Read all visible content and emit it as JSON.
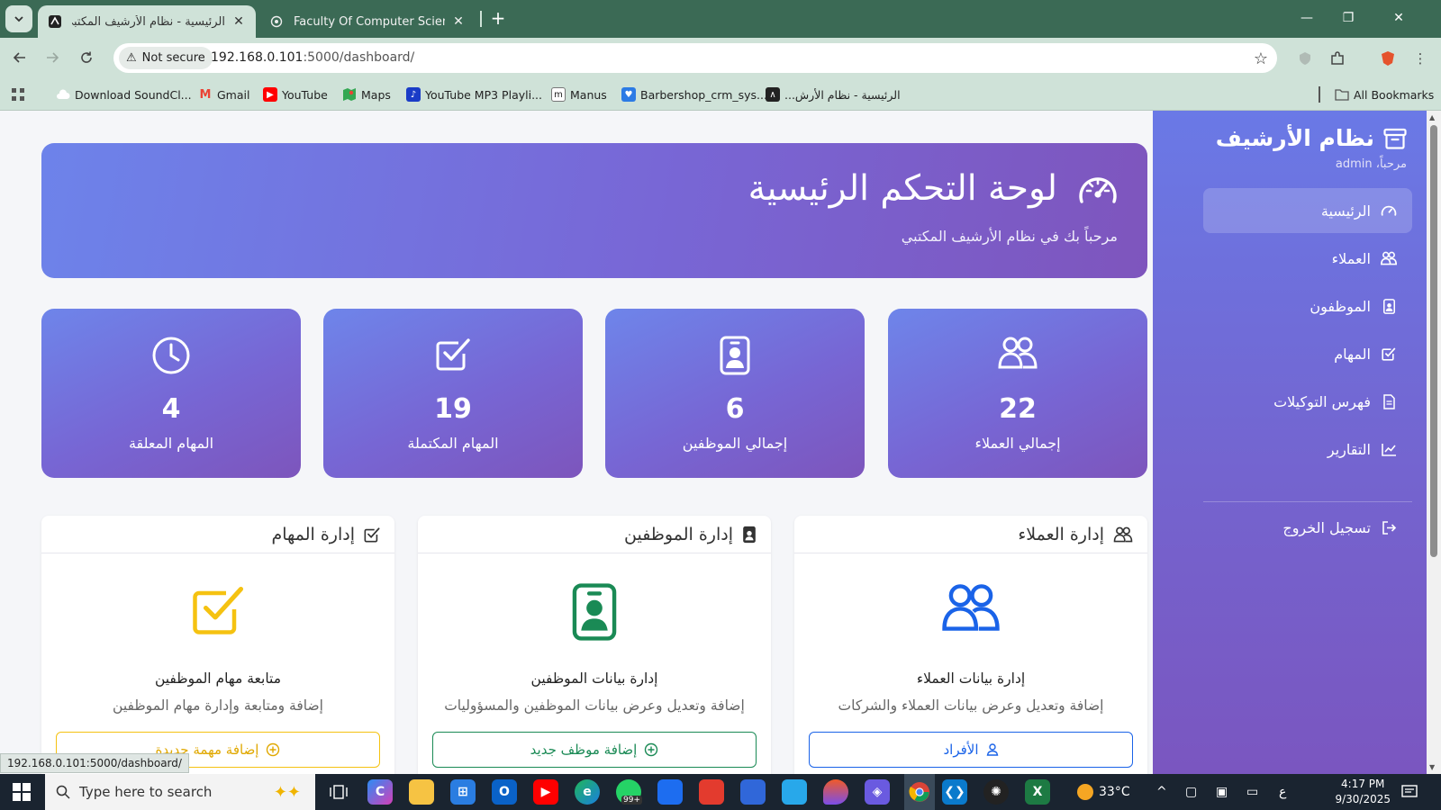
{
  "browser": {
    "tabs": [
      {
        "title": "الرئيسية - نظام الأرشيف المكتبي",
        "active": true
      },
      {
        "title": "Faculty Of Computer Science an",
        "active": false
      }
    ],
    "new_tab_label": "+",
    "window_controls": {
      "minimize": "—",
      "restore": "❐",
      "close": "✕"
    },
    "security_label": "Not secure",
    "url_host": "192.168.0.101",
    "url_path": ":5000/dashboard/",
    "bookmarks": [
      {
        "label": "Download SoundCl...",
        "icon": "cloud-icon",
        "color": "#ffffff"
      },
      {
        "label": "Gmail",
        "icon": "gmail-icon",
        "color": "#ea4335"
      },
      {
        "label": "YouTube",
        "icon": "youtube-icon",
        "color": "#ff0000"
      },
      {
        "label": "Maps",
        "icon": "maps-icon",
        "color": "#34a853"
      },
      {
        "label": "YouTube MP3 Playli...",
        "icon": "youtube-mp3-icon",
        "color": "#1a3cc7"
      },
      {
        "label": "Manus",
        "icon": "manus-icon",
        "color": "#222222"
      },
      {
        "label": "Barbershop_crm_sys...",
        "icon": "lovable-icon",
        "color": "#2c7be5"
      },
      {
        "label": "الرئيسية - نظام الأرش...",
        "icon": "archive-favicon-icon",
        "color": "#222222"
      }
    ],
    "all_bookmarks_label": "All Bookmarks",
    "status_url": "192.168.0.101:5000/dashboard/"
  },
  "sidebar": {
    "brand": "نظام الأرشيف",
    "welcome": "مرحباً، admin",
    "items": [
      {
        "label": "الرئيسية",
        "icon": "speedometer-icon",
        "active": true
      },
      {
        "label": "العملاء",
        "icon": "people-icon",
        "active": false
      },
      {
        "label": "الموظفون",
        "icon": "id-badge-icon",
        "active": false
      },
      {
        "label": "المهام",
        "icon": "check-square-icon",
        "active": false
      },
      {
        "label": "فهرس التوكيلات",
        "icon": "document-icon",
        "active": false
      },
      {
        "label": "التقارير",
        "icon": "chart-line-icon",
        "active": false
      }
    ],
    "logout": {
      "label": "تسجيل الخروج",
      "icon": "logout-icon"
    }
  },
  "hero": {
    "title": "لوحة التحكم الرئيسية",
    "subtitle": "مرحباً بك في نظام الأرشيف المكتبي"
  },
  "stats": [
    {
      "value": "22",
      "label": "إجمالي العملاء",
      "icon": "people-icon"
    },
    {
      "value": "6",
      "label": "إجمالي الموظفين",
      "icon": "id-badge-icon"
    },
    {
      "value": "19",
      "label": "المهام المكتملة",
      "icon": "check-square-icon"
    },
    {
      "value": "4",
      "label": "المهام المعلقة",
      "icon": "clock-icon"
    }
  ],
  "cards": [
    {
      "header": "إدارة العملاء",
      "title": "إدارة بيانات العملاء",
      "description": "إضافة وتعديل وعرض بيانات العملاء والشركات",
      "button": "الأفراد",
      "accent": "#1a63e8"
    },
    {
      "header": "إدارة الموظفين",
      "title": "إدارة بيانات الموظفين",
      "description": "إضافة وتعديل وعرض بيانات الموظفين والمسؤوليات",
      "button": "إضافة موظف جديد",
      "accent": "#1a8a55"
    },
    {
      "header": "إدارة المهام",
      "title": "متابعة مهام الموظفين",
      "description": "إضافة ومتابعة وإدارة مهام الموظفين",
      "button": "إضافة مهمة جديدة",
      "accent": "#f5c211"
    }
  ],
  "colors": {
    "gradient_start": "#6d83ea",
    "gradient_end": "#7e55bd",
    "chrome_green": "#3b6a55",
    "chrome_light": "#cfe2d8"
  },
  "taskbar": {
    "search_placeholder": "Type here to search",
    "weather": "33°C",
    "time": "4:17 PM",
    "date": "9/30/2025",
    "language": "ع",
    "notification_badge": "99+"
  }
}
